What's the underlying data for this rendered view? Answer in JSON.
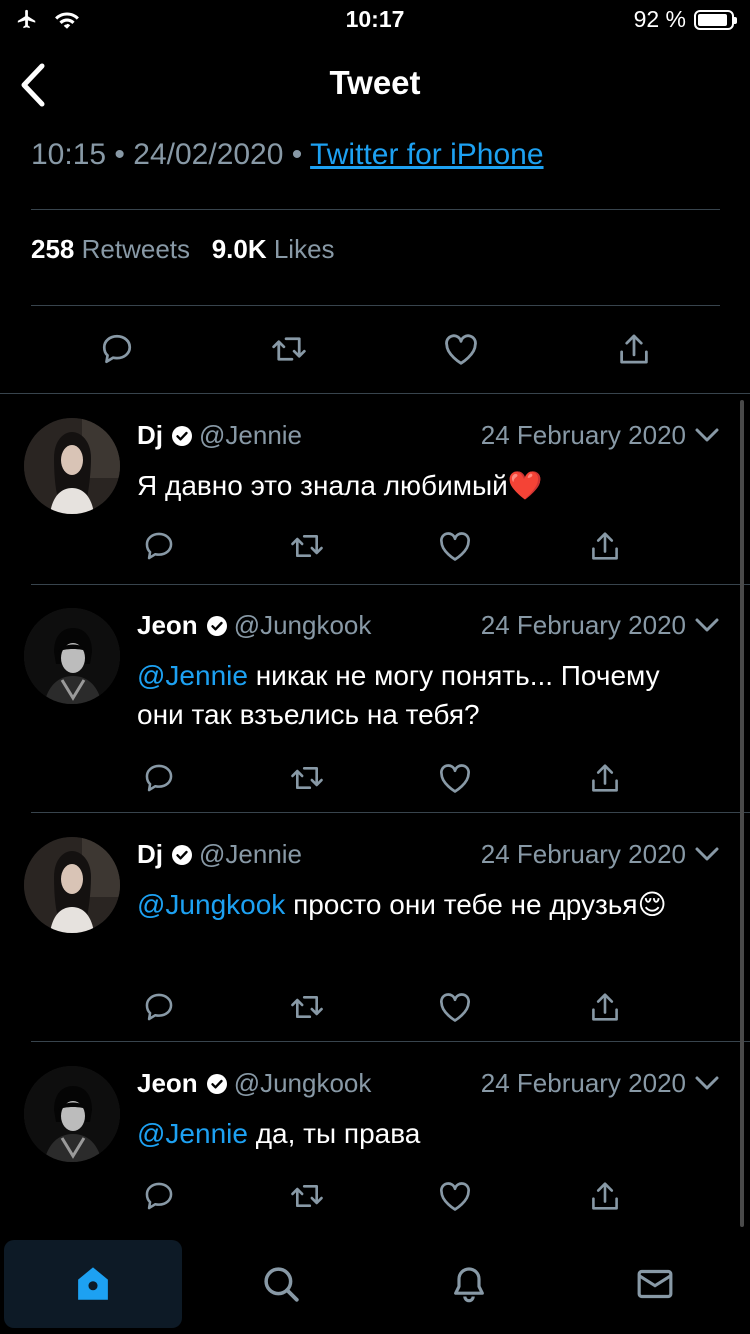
{
  "status_bar": {
    "time": "10:17",
    "battery_label": "92 %",
    "battery_level": 0.92,
    "icons": [
      "airplane-icon",
      "wifi-icon",
      "battery-icon"
    ]
  },
  "header": {
    "title": "Tweet",
    "back_icon": "chevron-left-icon"
  },
  "tweet": {
    "time": "10:15",
    "separator": "•",
    "date": "24/02/2020",
    "source": "Twitter for iPhone",
    "retweets_count": "258",
    "retweets_label": "Retweets",
    "likes_count": "9.0K",
    "likes_label": "Likes",
    "actions": [
      "reply-icon",
      "retweet-icon",
      "like-icon",
      "share-icon"
    ]
  },
  "replies": [
    {
      "name": "Dj",
      "handle": "@Jennie",
      "date": "24 February 2020",
      "mention": "",
      "text": "Я давно это знала любимый",
      "emoji": "❤️"
    },
    {
      "name": "Jeon",
      "handle": "@Jungkook",
      "date": "24 February 2020",
      "mention": "@Jennie",
      "text": " никак не могу понять... Почему они так взъелись на тебя?",
      "emoji": ""
    },
    {
      "name": "Dj",
      "handle": "@Jennie",
      "date": "24 February 2020",
      "mention": "@Jungkook",
      "text": " просто они тебе не друзья",
      "emoji": "😌"
    },
    {
      "name": "Jeon",
      "handle": "@Jungkook",
      "date": "24 February 2020",
      "mention": "@Jennie",
      "text": " да, ты права",
      "emoji": ""
    }
  ],
  "tab_bar": {
    "tabs": [
      "home-icon",
      "search-icon",
      "notifications-icon",
      "messages-icon"
    ],
    "active": "home-icon"
  },
  "colors": {
    "background": "#000000",
    "accent": "#1da1f2",
    "secondary_text": "#8899a6",
    "divider": "#38444d"
  }
}
